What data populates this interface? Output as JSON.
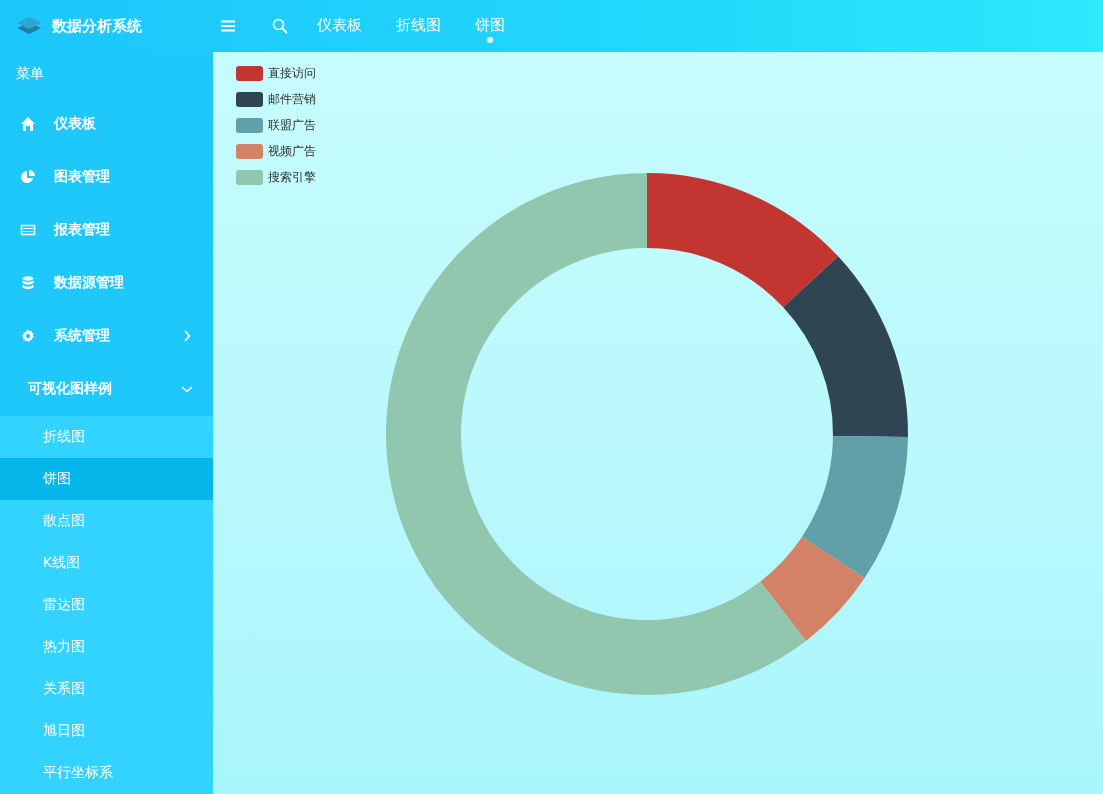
{
  "app": {
    "title": "数据分析系统"
  },
  "top_tabs": [
    {
      "label": "仪表板",
      "selected": false
    },
    {
      "label": "折线图",
      "selected": false
    },
    {
      "label": "饼图",
      "selected": true
    }
  ],
  "sidebar": {
    "heading": "菜单",
    "items": [
      {
        "label": "仪表板"
      },
      {
        "label": "图表管理"
      },
      {
        "label": "报表管理"
      },
      {
        "label": "数据源管理"
      },
      {
        "label": "系统管理",
        "expanded": false
      },
      {
        "label": "可视化图样例",
        "expanded": true,
        "children": [
          {
            "label": "折线图",
            "selected": false
          },
          {
            "label": "饼图",
            "selected": true
          },
          {
            "label": "散点图",
            "selected": false
          },
          {
            "label": "K线图",
            "selected": false
          },
          {
            "label": "雷达图",
            "selected": false
          },
          {
            "label": "热力图",
            "selected": false
          },
          {
            "label": "关系图",
            "selected": false
          },
          {
            "label": "旭日图",
            "selected": false
          },
          {
            "label": "平行坐标系",
            "selected": false
          }
        ]
      }
    ]
  },
  "legend": [
    {
      "label": "直接访问",
      "color": "#c23531"
    },
    {
      "label": "邮件营销",
      "color": "#2f4554"
    },
    {
      "label": "联盟广告",
      "color": "#61a0a8"
    },
    {
      "label": "视频广告",
      "color": "#d48265"
    },
    {
      "label": "搜索引擎",
      "color": "#91c7ae"
    }
  ]
}
